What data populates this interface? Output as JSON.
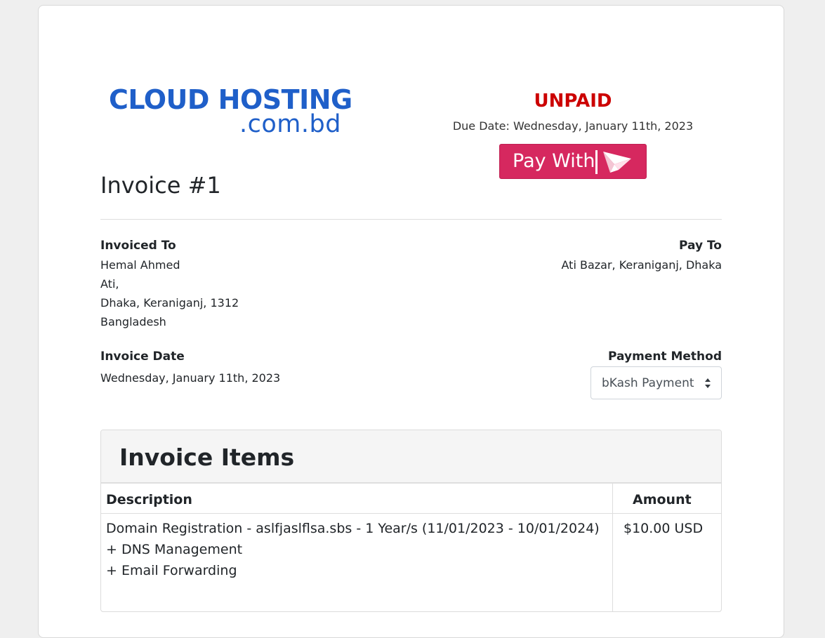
{
  "logo": {
    "main": "CLOUD HOSTING",
    "sub": ".com.bd"
  },
  "status": {
    "label": "UNPAID",
    "due_date": "Due Date: Wednesday, January 11th, 2023",
    "color": "#cc0000"
  },
  "pay_button": {
    "label": "Pay With",
    "icon": "bkash-bird-icon",
    "color": "#d6285f"
  },
  "invoice": {
    "title": "Invoice #1"
  },
  "invoiced_to": {
    "label": "Invoiced To",
    "lines": [
      "Hemal Ahmed",
      "Ati,",
      "Dhaka, Keraniganj, 1312",
      "Bangladesh"
    ]
  },
  "pay_to": {
    "label": "Pay To",
    "address": "Ati Bazar, Keraniganj, Dhaka"
  },
  "invoice_date": {
    "label": "Invoice Date",
    "value": "Wednesday, January 11th, 2023"
  },
  "payment_method": {
    "label": "Payment Method",
    "selected": "bKash Payment"
  },
  "items": {
    "heading": "Invoice Items",
    "columns": [
      "Description",
      "Amount"
    ],
    "rows": [
      {
        "description_lines": [
          "Domain Registration - aslfjaslflsa.sbs - 1 Year/s (11/01/2023 - 10/01/2024)",
          "+ DNS Management",
          "+ Email Forwarding"
        ],
        "amount": "$10.00 USD"
      }
    ]
  }
}
